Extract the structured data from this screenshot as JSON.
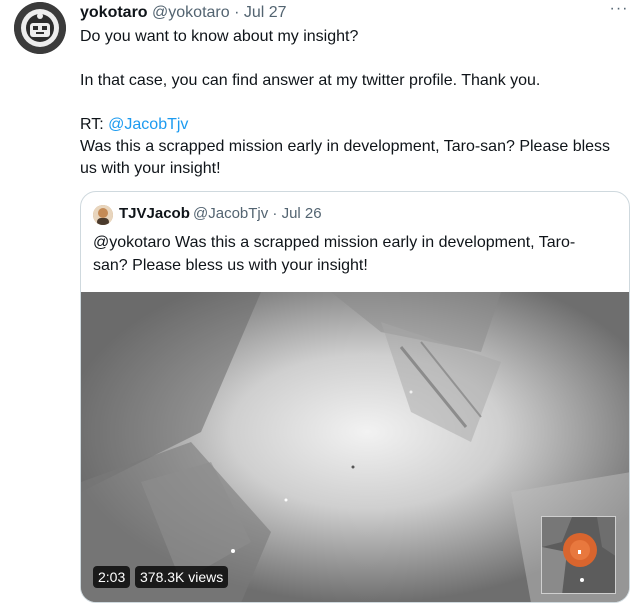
{
  "tweet": {
    "author_name": "yokotaro",
    "author_handle": "@yokotaro",
    "separator": "·",
    "date": "Jul 27",
    "more_label": "···",
    "lines": {
      "l1": "Do you want to know about my insight?",
      "l2": "In that case, you can find answer at  my twitter profile. Thank you.",
      "rt_prefix": "RT: ",
      "rt_mention": "@JacobTjv",
      "l4": "Was this a scrapped mission early in development, Taro-san? Please bless us with your insight!"
    }
  },
  "quote": {
    "author_name": "TJVJacob",
    "author_handle": "@JacobTjv",
    "separator": "·",
    "date": "Jul 26",
    "text": "@yokotaro Was this a scrapped mission early in development, Taro-san? Please bless us with your insight!",
    "video": {
      "duration": "2:03",
      "views": "378.3K views"
    }
  },
  "icons": {
    "avatar": "mask-avatar-icon",
    "quote_avatar": "profile-avatar-icon",
    "more": "more-options-icon"
  },
  "colors": {
    "link": "#1d9bf0",
    "muted": "#536471",
    "border": "#cfd9de"
  }
}
